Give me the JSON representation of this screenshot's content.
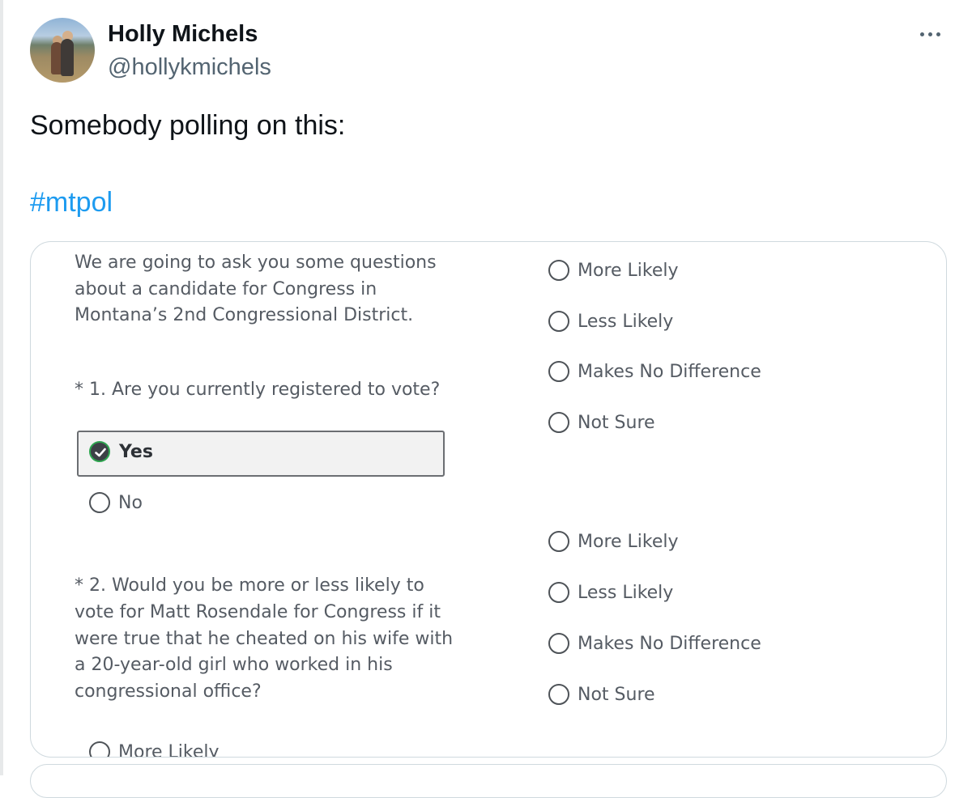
{
  "author": {
    "name": "Holly Michels",
    "handle": "@hollykmichels",
    "avatar_icon": "profile-photo"
  },
  "tweet": {
    "text": "Somebody polling on this:",
    "hashtag": "#mtpol"
  },
  "survey": {
    "intro": "We are going to ask you some questions about a candidate for Congress in Montana’s 2nd Congressional District.",
    "question1": {
      "text": "* 1. Are you currently registered to vote?",
      "options": [
        "Yes",
        "No"
      ],
      "selected": "Yes"
    },
    "right_group_1": [
      "More Likely",
      "Less Likely",
      "Makes No Difference",
      "Not Sure"
    ],
    "right_group_2": [
      "More Likely",
      "Less Likely",
      "Makes No Difference",
      "Not Sure"
    ],
    "question2": {
      "text": "* 2. Would you be more or less likely to vote for Matt Rosendale for Congress if it were true that he cheated on his wife with a 20-year-old girl who worked in his congressional office?"
    },
    "bottom_option": "More Likely"
  },
  "colors": {
    "hashtag": "#1d9bf0",
    "check_ring": "#2ea44f"
  }
}
